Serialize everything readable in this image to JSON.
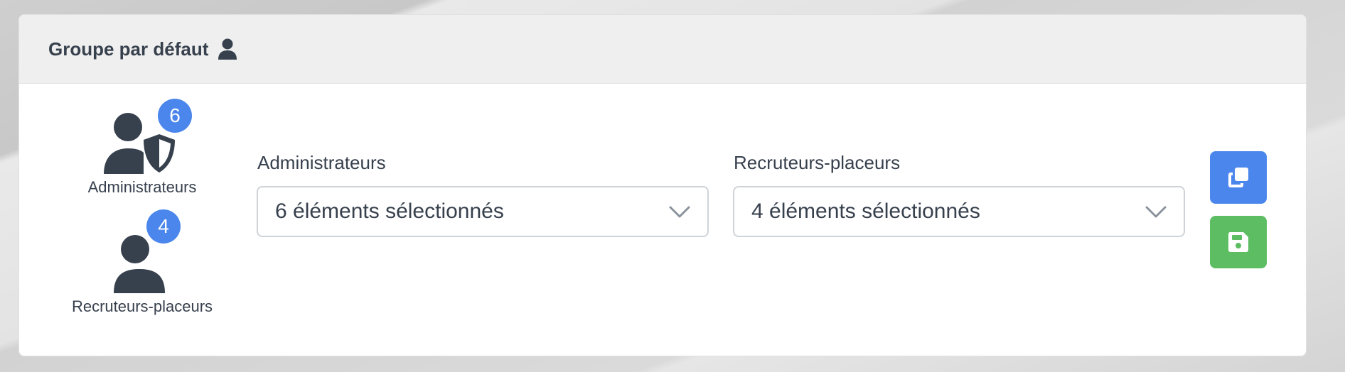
{
  "header": {
    "title": "Groupe par défaut",
    "title_icon": "user-icon"
  },
  "groups": [
    {
      "label": "Administrateurs",
      "count": "6",
      "icon": "user-shield-icon"
    },
    {
      "label": "Recruteurs-placeurs",
      "count": "4",
      "icon": "user-icon"
    }
  ],
  "fields": [
    {
      "label": "Administrateurs",
      "value": "6 éléments sélectionnés"
    },
    {
      "label": "Recruteurs-placeurs",
      "value": "4 éléments sélectionnés"
    }
  ],
  "actions": [
    {
      "name": "copy",
      "icon": "copy-icon",
      "color": "#4b86ec"
    },
    {
      "name": "save",
      "icon": "save-icon",
      "color": "#5cbd62"
    }
  ],
  "colors": {
    "text": "#37404d",
    "accent": "#4b86ec",
    "success": "#5cbd62"
  }
}
